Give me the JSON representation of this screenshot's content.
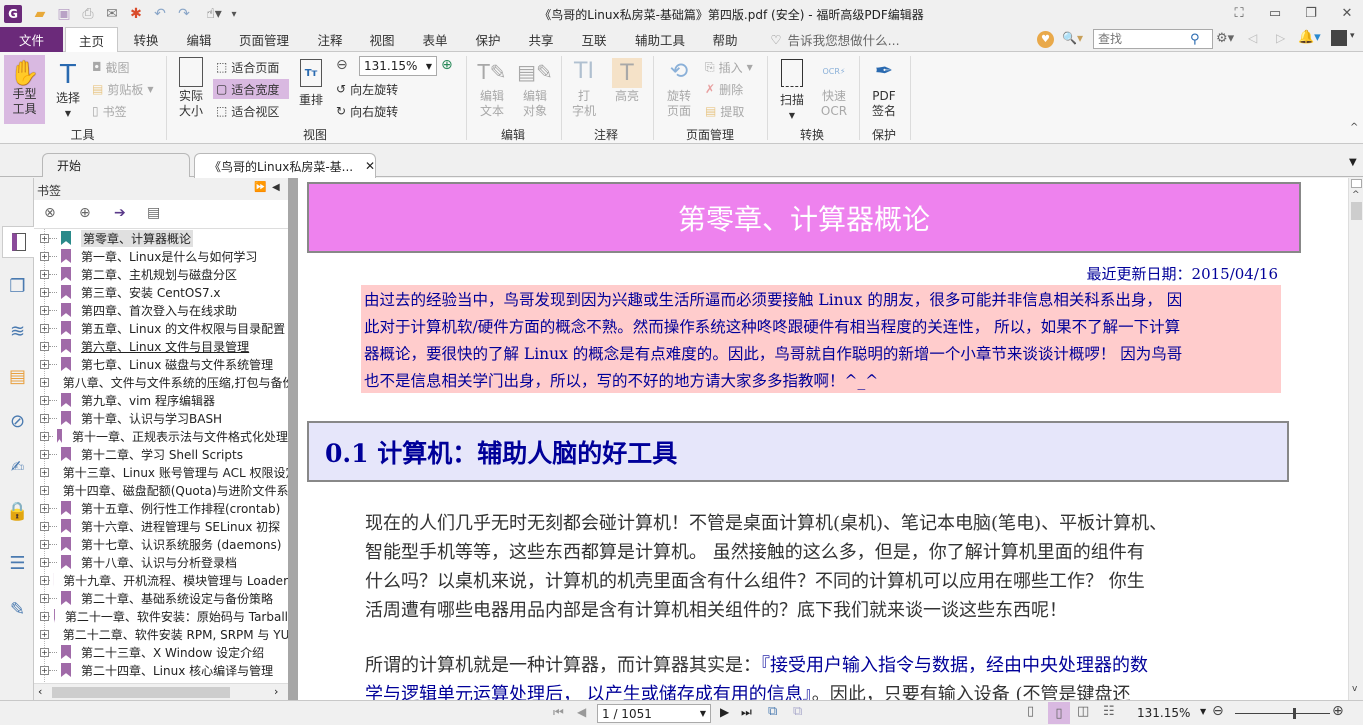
{
  "window": {
    "title": "《鸟哥的Linux私房菜-基础篇》第四版.pdf (安全) - 福昕高级PDF编辑器",
    "quick_access": [
      "app-logo-icon",
      "open-icon",
      "save-icon",
      "print-icon",
      "email-icon",
      "new-icon",
      "undo-icon",
      "redo-icon",
      "hand-pointer-icon"
    ],
    "controls": [
      "fullscreen-icon",
      "minimize-icon",
      "restore-icon",
      "close-icon"
    ]
  },
  "menu": {
    "file": "文件",
    "tabs": [
      "主页",
      "转换",
      "编辑",
      "页面管理",
      "注释",
      "视图",
      "表单",
      "保护",
      "共享",
      "互联",
      "辅助工具",
      "帮助"
    ],
    "active_tab": "主页",
    "tell_me": "告诉我您想做什么...",
    "search_placeholder": "查找"
  },
  "ribbon": {
    "tools": {
      "hand": "手型\n工具",
      "hand_l1": "手型",
      "hand_l2": "工具",
      "select": "选择",
      "screenshot": "截图",
      "clipboard": "剪贴板",
      "bookmark": "书签",
      "group": "工具"
    },
    "view": {
      "actual_l1": "实际",
      "actual_l2": "大小",
      "fit_page": "适合页面",
      "fit_width": "适合宽度",
      "fit_visible": "适合视区",
      "reflow": "重排",
      "zoom_value": "131.15%",
      "rotate_left": "向左旋转",
      "rotate_right": "向右旋转",
      "group": "视图"
    },
    "edit": {
      "text_l1": "编辑",
      "text_l2": "文本",
      "obj_l1": "编辑",
      "obj_l2": "对象",
      "group": "编辑"
    },
    "comment": {
      "type_l1": "打",
      "type_l2": "字机",
      "highlight": "高亮",
      "group": "注释"
    },
    "pages": {
      "rotate_l1": "旋转",
      "rotate_l2": "页面",
      "insert": "插入",
      "delete": "删除",
      "extract": "提取",
      "group": "页面管理"
    },
    "convert": {
      "scan": "扫描",
      "ocr_l1": "快速",
      "ocr_l2": "OCR",
      "group": "转换"
    },
    "protect": {
      "sign_l1": "PDF",
      "sign_l2": "签名",
      "group": "保护"
    }
  },
  "doc_tabs": [
    {
      "label": "开始",
      "active": false
    },
    {
      "label": "《鸟哥的Linux私房菜-基...",
      "active": true
    }
  ],
  "bookmarks": {
    "title": "书签",
    "items": [
      {
        "label": "第零章、计算器概论",
        "selected": true
      },
      {
        "label": "第一章、Linux是什么与如何学习"
      },
      {
        "label": "第二章、主机规划与磁盘分区"
      },
      {
        "label": "第三章、安装 CentOS7.x"
      },
      {
        "label": "第四章、首次登入与在线求助"
      },
      {
        "label": "第五章、Linux 的文件权限与目录配置"
      },
      {
        "label": "第六章、Linux 文件与目录管理",
        "underline": true
      },
      {
        "label": "第七章、Linux 磁盘与文件系统管理"
      },
      {
        "label": "第八章、文件与文件系统的压缩,打包与备份"
      },
      {
        "label": "第九章、vim 程序编辑器"
      },
      {
        "label": "第十章、认识与学习BASH"
      },
      {
        "label": "第十一章、正规表示法与文件格式化处理"
      },
      {
        "label": "第十二章、学习 Shell Scripts"
      },
      {
        "label": "第十三章、Linux 账号管理与 ACL 权限设定"
      },
      {
        "label": "第十四章、磁盘配额(Quota)与进阶文件系统管理"
      },
      {
        "label": "第十五章、例行性工作排程(crontab)"
      },
      {
        "label": "第十六章、进程管理与 SELinux 初探"
      },
      {
        "label": "第十七章、认识系统服务 (daemons)"
      },
      {
        "label": "第十八章、认识与分析登录档"
      },
      {
        "label": "第十九章、开机流程、模块管理与 Loader"
      },
      {
        "label": "第二十章、基础系统设定与备份策略"
      },
      {
        "label": "第二十一章、软件安装：原始码与 Tarball"
      },
      {
        "label": "第二十二章、软件安装 RPM, SRPM 与 YUM"
      },
      {
        "label": "第二十三章、X Window 设定介绍"
      },
      {
        "label": "第二十四章、Linux 核心编译与管理"
      }
    ]
  },
  "left_panel_icons": [
    "bookmarks-icon",
    "pages-icon",
    "layers-icon",
    "comments-icon",
    "attachments-icon",
    "signature-icon",
    "security-icon",
    "form-icon",
    "certify-icon"
  ],
  "document": {
    "chapter_title": "第零章、计算器概论",
    "updated": "最近更新日期：2015/04/16",
    "intro_lines": [
      "由过去的经验当中，鸟哥发现到因为兴趣或生活所逼而必须要接触 Linux 的朋友，很多可能并非信息相关科系出身， 因",
      "此对于计算机软/硬件方面的概念不熟。然而操作系统这种咚咚跟硬件有相当程度的关连性， 所以，如果不了解一下计算",
      "器概论，要很快的了解 Linux 的概念是有点难度的。因此，鸟哥就自作聪明的新增一个小章节来谈谈计概啰！ 因为鸟哥",
      "也不是信息相关学门出身，所以，写的不好的地方请大家多多指教啊！^_^"
    ],
    "section_title": "0.1  计算机：辅助人脑的好工具",
    "para1_lines": [
      "现在的人们几乎无时无刻都会碰计算机！不管是桌面计算机(桌机)、笔记本电脑(笔电)、平板计算机、",
      "智能型手机等等，这些东西都算是计算机。 虽然接触的这么多，但是，你了解计算机里面的组件有",
      "什么吗？以桌机来说，计算机的机壳里面含有什么组件？不同的计算机可以应用在哪些工作？ 你生",
      "活周遭有哪些电器用品内部是含有计算机相关组件的？底下我们就来谈一谈这些东西呢！"
    ],
    "para2_prefix": "所谓的计算机就是一种计算器，而计算器其实是：",
    "para2_quote": "『接受用户输入指令与数据，经由中央处理器的数",
    "para2_line2_quote": "学与逻辑单元运算处理后， 以产生或储存成有用的信息』",
    "para2_line2_rest": "。因此，只要有输入设备 (不管是键盘还"
  },
  "status": {
    "page": "1 / 1051",
    "zoom": "131.15%",
    "zoom_fraction": 0.62
  },
  "colors": {
    "brand": "#6b2a7a",
    "chapter_bg": "#ee82ee",
    "intro_bg": "#ffcccc",
    "section_bg": "#e6e6fa",
    "text_blue": "#000099",
    "bookmark_flag": "#a06aa8",
    "bookmark_flag_selected": "#2a8a8a"
  }
}
